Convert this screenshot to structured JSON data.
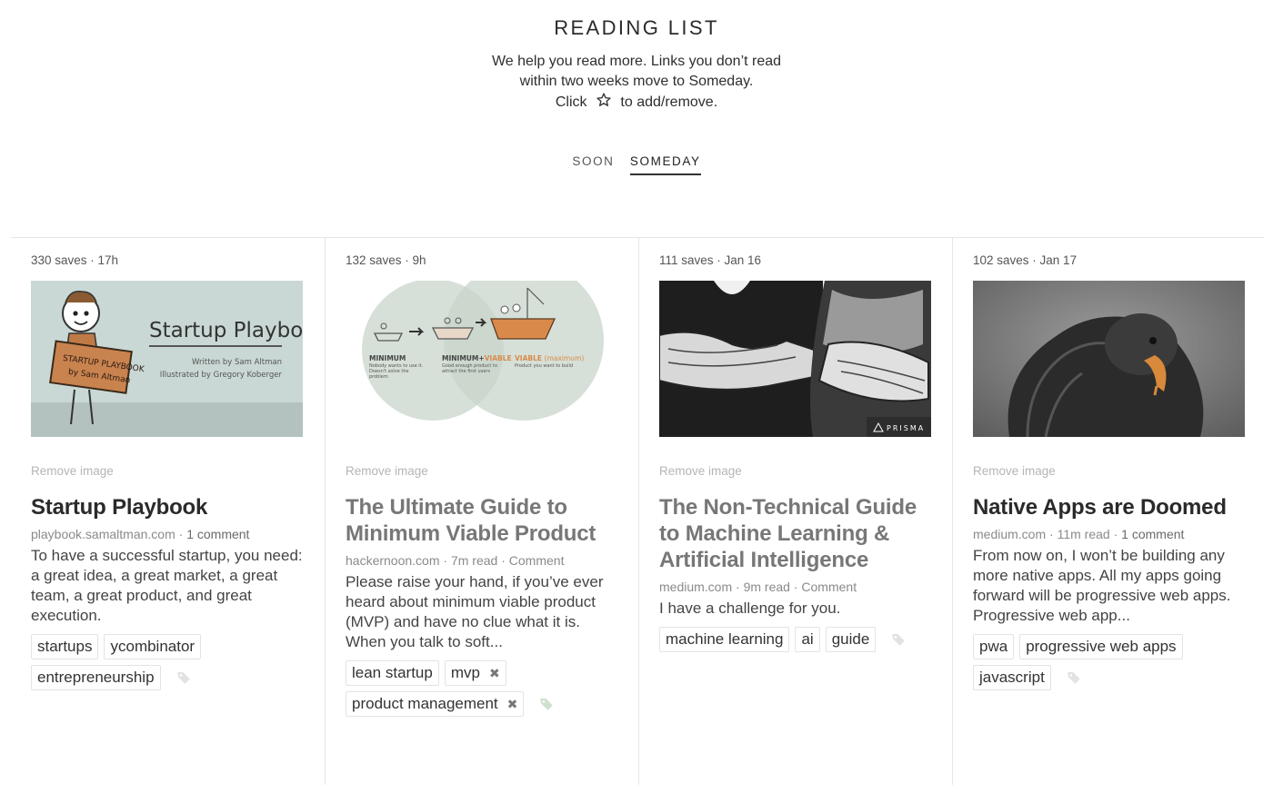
{
  "header": {
    "title": "READING LIST",
    "intro_line1": "We help you read more. Links you don’t read",
    "intro_line2": "within two weeks move to Someday.",
    "intro_line3_pre": "Click",
    "intro_line3_post": "to add/remove."
  },
  "tabs": [
    {
      "label": "SOON",
      "active": false
    },
    {
      "label": "SOMEDAY",
      "active": true
    }
  ],
  "articles": [
    {
      "meta": "330 saves · 17h",
      "remove_label": "Remove image",
      "title": "Startup Playbook",
      "source": "playbook.samaltman.com",
      "read_time": "",
      "comment": "1 comment",
      "description": "To have a successful startup, you need: a great idea, a great market, a great team, a great product, and great execution.",
      "tags": [
        "startups",
        "ycombinator",
        "entrepreneurship"
      ],
      "image_text": {
        "heading": "Startup Playbook",
        "line1": "Written by Sam Altman",
        "line2": "Illustrated by Gregory Koberger",
        "sign1": "STARTUP PLAYBOOK",
        "sign2": "by Sam Altman"
      }
    },
    {
      "meta": "132 saves · 9h",
      "remove_label": "Remove image",
      "title": "The Ultimate Guide to Minimum Viable Product",
      "source": "hackernoon.com",
      "read_time": "7m read",
      "comment": "Comment",
      "description": "Please raise your hand, if you’ve ever heard about minimum viable product (MVP) and have no clue what it is. When you talk to soft...",
      "tags": [
        "lean startup",
        "mvp",
        "product management"
      ],
      "image_text": {
        "label1": "MINIMUM",
        "label2_a": "MINIMUM+",
        "label2_b": "VIABLE",
        "label3": "VIABLE",
        "label3_b": "(maximum)",
        "sub1": "Nobody wants to use it. Doesn't solve the problem",
        "sub2": "Good enough product to attract the first users",
        "sub3": "Product you want to build"
      }
    },
    {
      "meta": "111 saves · Jan 16",
      "remove_label": "Remove image",
      "title": "The Non-Technical Guide to Machine Learning & Artificial Intelligence",
      "source": "medium.com",
      "read_time": "9m read",
      "comment": "Comment",
      "description": "I have a challenge for you.",
      "tags": [
        "machine learning",
        "ai",
        "guide"
      ],
      "image_text": {
        "watermark": "PRISMA"
      }
    },
    {
      "meta": "102 saves · Jan 17",
      "remove_label": "Remove image",
      "title": "Native Apps are Doomed",
      "source": "medium.com",
      "read_time": "11m read",
      "comment": "1 comment",
      "description": "From now on, I won’t be building any more native apps. All my apps going forward will be progressive web apps. Progressive web app...",
      "tags": [
        "pwa",
        "progressive web apps",
        "javascript"
      ],
      "image_text": {}
    }
  ],
  "colors": {
    "tag_border": "#e3e3e3",
    "muted": "#b5b5b5",
    "title_unread": "#777777",
    "title_read": "#2a2a2a",
    "mvp_orange": "#d98a4a",
    "card_bg_1": "#c9d8d4"
  }
}
